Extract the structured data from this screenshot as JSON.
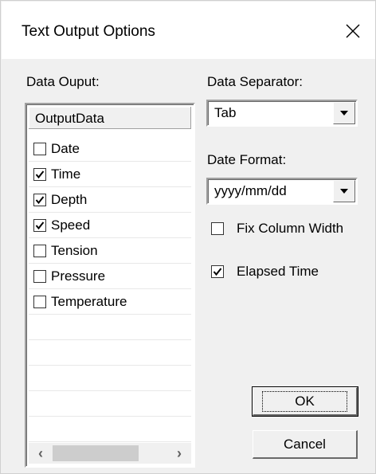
{
  "window": {
    "title": "Text Output Options"
  },
  "data_output": {
    "label": "Data Ouput:",
    "column_header": "OutputData",
    "items": [
      {
        "label": "Date",
        "checked": false
      },
      {
        "label": "Time",
        "checked": true
      },
      {
        "label": "Depth",
        "checked": true
      },
      {
        "label": "Speed",
        "checked": true
      },
      {
        "label": "Tension",
        "checked": false
      },
      {
        "label": "Pressure",
        "checked": false
      },
      {
        "label": "Temperature",
        "checked": false
      }
    ]
  },
  "separator": {
    "label": "Data Separator:",
    "value": "Tab"
  },
  "date_format": {
    "label": "Date Format:",
    "value": "yyyy/mm/dd"
  },
  "options": {
    "fix_column_width": {
      "label": "Fix Column Width",
      "checked": false
    },
    "elapsed_time": {
      "label": "Elapsed Time",
      "checked": true
    }
  },
  "buttons": {
    "ok": "OK",
    "cancel": "Cancel"
  }
}
